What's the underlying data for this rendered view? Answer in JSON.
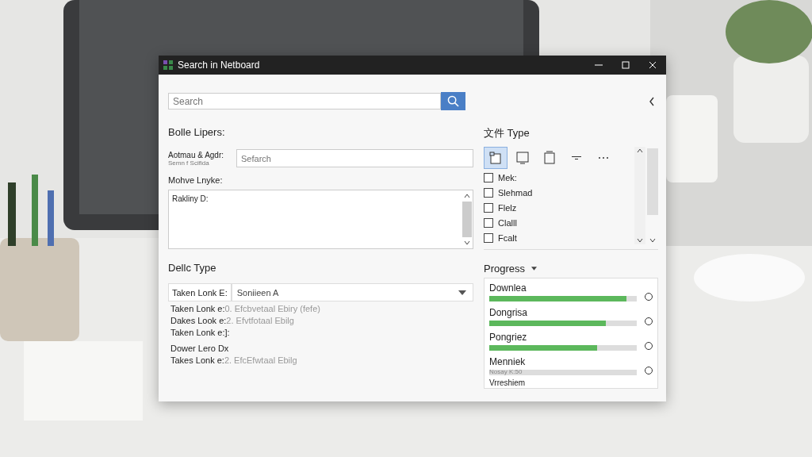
{
  "window": {
    "title": "Search in Netboard"
  },
  "search": {
    "placeholder": "Search"
  },
  "section_1": {
    "heading": "Bolle Lipers:",
    "field_label": "Aotmau & Agdr:",
    "field_hint": "Semn f Scifida",
    "field_placeholder": "Sefarch",
    "text_label": "Mohve Lnyke:",
    "text_value": "Rakliny D:"
  },
  "file_type": {
    "heading": "文件 Type",
    "tools": [
      {
        "kind": "folder",
        "selected": true
      },
      {
        "kind": "monitor",
        "selected": false
      },
      {
        "kind": "page",
        "selected": false
      },
      {
        "kind": "filter",
        "selected": false
      },
      {
        "kind": "more",
        "selected": false
      }
    ],
    "items": [
      {
        "label": "Mek:",
        "checked": false
      },
      {
        "label": "Slehmad",
        "checked": false
      },
      {
        "label": "Flelz",
        "checked": false
      },
      {
        "label": "Clalll",
        "checked": false
      },
      {
        "label": "Fcalt",
        "checked": false
      }
    ]
  },
  "section_2": {
    "heading": "Dellc Type",
    "select_label": "Taken Lonk E:",
    "select_value": "Soniieen A",
    "rows": [
      {
        "label": "Taken Lonk e:",
        "detail": "0. Efcbvetaal Ebiry (fefe)"
      },
      {
        "label": "Dakes Look e:",
        "detail": "2. Efvtfotaal Ebilg"
      },
      {
        "label": "Taken Lonk e:]:"
      },
      {
        "label": "Dower Lero Dx"
      },
      {
        "label": "Takes Lonk e:",
        "detail": "2. EfcEfwtaal Ebilg"
      }
    ]
  },
  "progress": {
    "heading": "Progress",
    "items": [
      {
        "name": "Downlea",
        "level": 0.93
      },
      {
        "name": "Dongrisa",
        "level": 0.79
      },
      {
        "name": "Pongriez",
        "level": 0.73
      },
      {
        "name": "Menniek",
        "note": "Nosay K:50"
      }
    ],
    "footer": "Vrreshiem"
  }
}
